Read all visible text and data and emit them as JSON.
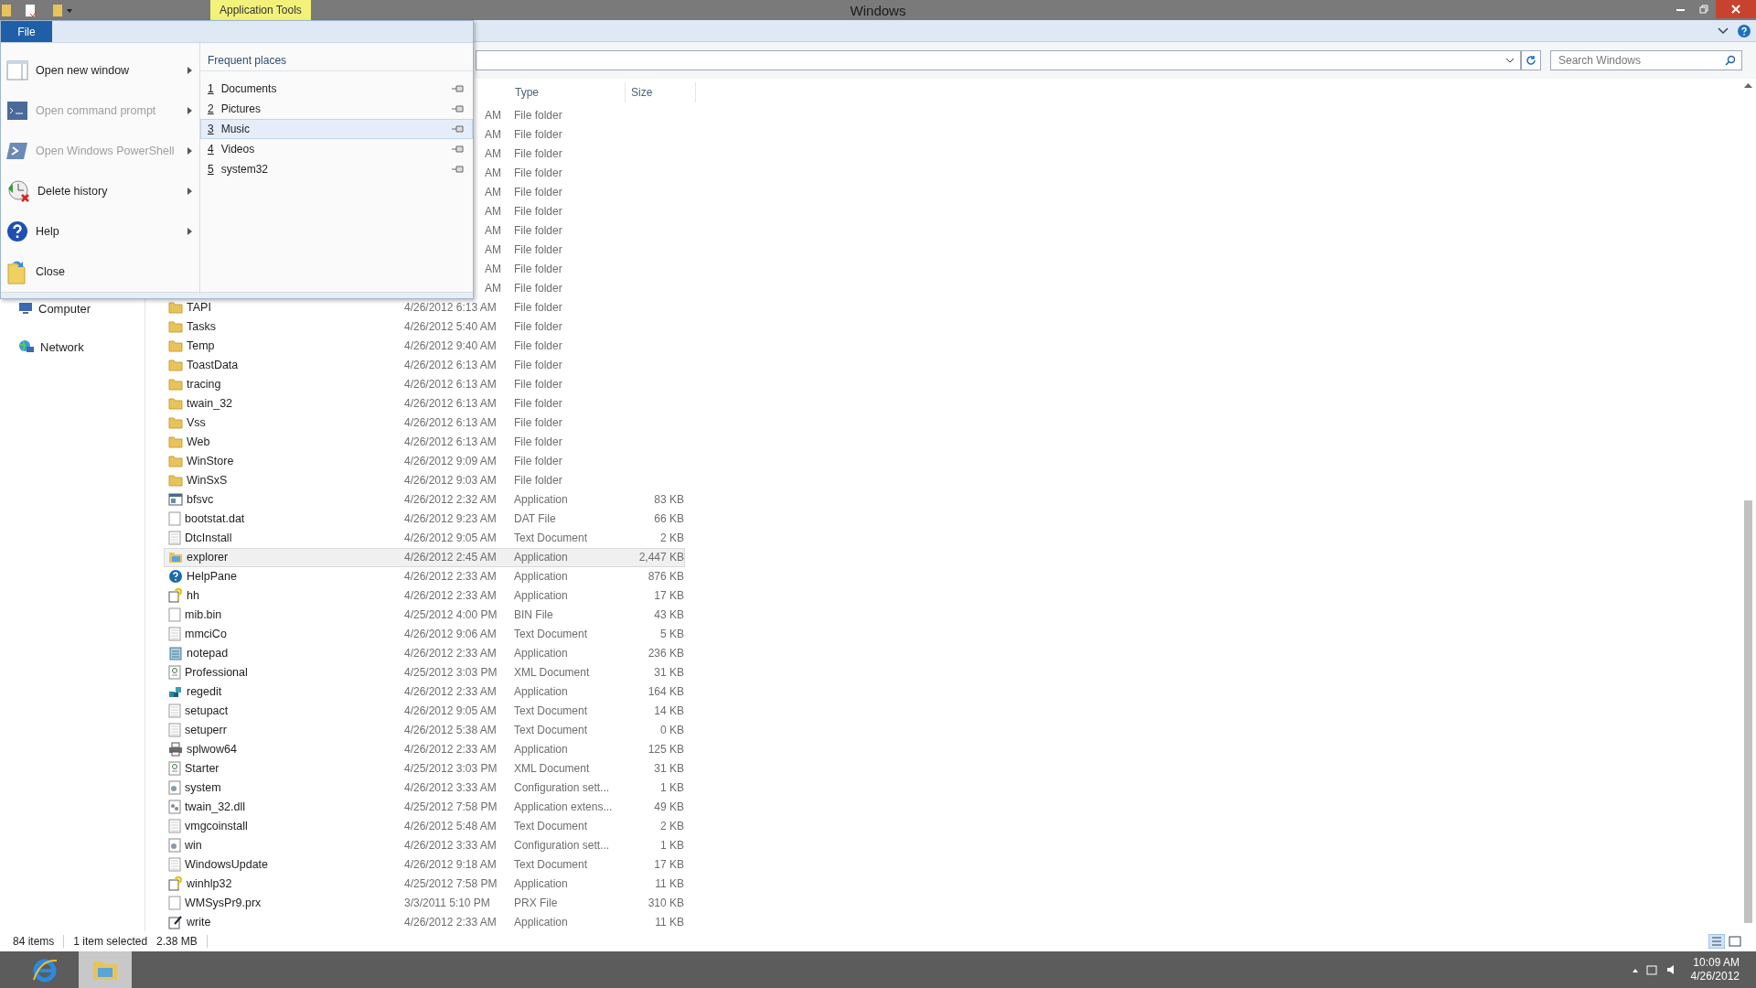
{
  "window": {
    "title": "Windows",
    "context_tab": "Application Tools"
  },
  "ribbon": {
    "file_tab": "File"
  },
  "search": {
    "placeholder": "Search Windows"
  },
  "columns": [
    "Type",
    "Size"
  ],
  "nav": [
    {
      "label": "Computer",
      "kind": "computer"
    },
    {
      "label": "Network",
      "kind": "network"
    }
  ],
  "rows": [
    {
      "date": "AM",
      "type": "File folder",
      "selected": false
    },
    {
      "date": "AM",
      "type": "File folder",
      "selected": false
    },
    {
      "date": "AM",
      "type": "File folder",
      "selected": false
    },
    {
      "date": "AM",
      "type": "File folder",
      "selected": false
    },
    {
      "date": "AM",
      "type": "File folder",
      "selected": false
    },
    {
      "date": "AM",
      "type": "File folder",
      "selected": false
    },
    {
      "date": "AM",
      "type": "File folder",
      "selected": false
    },
    {
      "date": "AM",
      "type": "File folder",
      "selected": false
    },
    {
      "date": "AM",
      "type": "File folder",
      "selected": false
    },
    {
      "date": "AM",
      "type": "File folder",
      "selected": false
    },
    {
      "name": "TAPI",
      "date": "4/26/2012 6:13 AM",
      "type": "File folder",
      "kind": "folder",
      "selected": false
    },
    {
      "name": "Tasks",
      "date": "4/26/2012 5:40 AM",
      "type": "File folder",
      "kind": "folder",
      "selected": false
    },
    {
      "name": "Temp",
      "date": "4/26/2012 9:40 AM",
      "type": "File folder",
      "kind": "folder",
      "selected": false
    },
    {
      "name": "ToastData",
      "date": "4/26/2012 6:13 AM",
      "type": "File folder",
      "kind": "folder",
      "selected": false
    },
    {
      "name": "tracing",
      "date": "4/26/2012 6:13 AM",
      "type": "File folder",
      "kind": "folder",
      "selected": false
    },
    {
      "name": "twain_32",
      "date": "4/26/2012 6:13 AM",
      "type": "File folder",
      "kind": "folder",
      "selected": false
    },
    {
      "name": "Vss",
      "date": "4/26/2012 6:13 AM",
      "type": "File folder",
      "kind": "folder",
      "selected": false
    },
    {
      "name": "Web",
      "date": "4/26/2012 6:13 AM",
      "type": "File folder",
      "kind": "folder",
      "selected": false
    },
    {
      "name": "WinStore",
      "date": "4/26/2012 9:09 AM",
      "type": "File folder",
      "kind": "folder",
      "selected": false
    },
    {
      "name": "WinSxS",
      "date": "4/26/2012 9:03 AM",
      "type": "File folder",
      "kind": "folder",
      "selected": false
    },
    {
      "name": "bfsvc",
      "date": "4/26/2012 2:32 AM",
      "type": "Application",
      "size": "83 KB",
      "kind": "app",
      "selected": false
    },
    {
      "name": "bootstat.dat",
      "date": "4/26/2012 9:23 AM",
      "type": "DAT File",
      "size": "66 KB",
      "kind": "file",
      "selected": false
    },
    {
      "name": "DtcInstall",
      "date": "4/26/2012 9:05 AM",
      "type": "Text Document",
      "size": "2 KB",
      "kind": "text",
      "selected": false
    },
    {
      "name": "explorer",
      "date": "4/26/2012 2:45 AM",
      "type": "Application",
      "size": "2,447 KB",
      "kind": "explorer",
      "selected": true
    },
    {
      "name": "HelpPane",
      "date": "4/26/2012 2:33 AM",
      "type": "Application",
      "size": "876 KB",
      "kind": "help",
      "selected": false
    },
    {
      "name": "hh",
      "date": "4/26/2012 2:33 AM",
      "type": "Application",
      "size": "17 KB",
      "kind": "hh",
      "selected": false
    },
    {
      "name": "mib.bin",
      "date": "4/25/2012 4:00 PM",
      "type": "BIN File",
      "size": "43 KB",
      "kind": "file",
      "selected": false
    },
    {
      "name": "mmciCo",
      "date": "4/26/2012 9:06 AM",
      "type": "Text Document",
      "size": "5 KB",
      "kind": "text",
      "selected": false
    },
    {
      "name": "notepad",
      "date": "4/26/2012 2:33 AM",
      "type": "Application",
      "size": "236 KB",
      "kind": "notepad",
      "selected": false
    },
    {
      "name": "Professional",
      "date": "4/25/2012 3:03 PM",
      "type": "XML Document",
      "size": "31 KB",
      "kind": "xml",
      "selected": false
    },
    {
      "name": "regedit",
      "date": "4/26/2012 2:33 AM",
      "type": "Application",
      "size": "164 KB",
      "kind": "regedit",
      "selected": false
    },
    {
      "name": "setupact",
      "date": "4/26/2012 9:05 AM",
      "type": "Text Document",
      "size": "14 KB",
      "kind": "text",
      "selected": false
    },
    {
      "name": "setuperr",
      "date": "4/26/2012 5:38 AM",
      "type": "Text Document",
      "size": "0 KB",
      "kind": "text",
      "selected": false
    },
    {
      "name": "splwow64",
      "date": "4/26/2012 2:33 AM",
      "type": "Application",
      "size": "125 KB",
      "kind": "printer",
      "selected": false
    },
    {
      "name": "Starter",
      "date": "4/25/2012 3:03 PM",
      "type": "XML Document",
      "size": "31 KB",
      "kind": "xml",
      "selected": false
    },
    {
      "name": "system",
      "date": "4/26/2012 3:33 AM",
      "type": "Configuration sett...",
      "size": "1 KB",
      "kind": "config",
      "selected": false
    },
    {
      "name": "twain_32.dll",
      "date": "4/25/2012 7:58 PM",
      "type": "Application extens...",
      "size": "49 KB",
      "kind": "dll",
      "selected": false
    },
    {
      "name": "vmgcoinstall",
      "date": "4/26/2012 5:48 AM",
      "type": "Text Document",
      "size": "2 KB",
      "kind": "text",
      "selected": false
    },
    {
      "name": "win",
      "date": "4/26/2012 3:33 AM",
      "type": "Configuration sett...",
      "size": "1 KB",
      "kind": "config",
      "selected": false
    },
    {
      "name": "WindowsUpdate",
      "date": "4/26/2012 9:18 AM",
      "type": "Text Document",
      "size": "17 KB",
      "kind": "text",
      "selected": false
    },
    {
      "name": "winhlp32",
      "date": "4/25/2012 7:58 PM",
      "type": "Application",
      "size": "11 KB",
      "kind": "hh",
      "selected": false
    },
    {
      "name": "WMSysPr9.prx",
      "date": "3/3/2011 5:10 PM",
      "type": "PRX File",
      "size": "310 KB",
      "kind": "file",
      "selected": false
    },
    {
      "name": "write",
      "date": "4/26/2012 2:33 AM",
      "type": "Application",
      "size": "11 KB",
      "kind": "write",
      "selected": false
    }
  ],
  "status_bar": {
    "count": "84 items",
    "selection": "1 item selected",
    "size": "2.38 MB"
  },
  "file_menu": {
    "commands": [
      {
        "label": "Open new window",
        "kind": "window",
        "disabled": false,
        "submenu": true
      },
      {
        "label": "Open command prompt",
        "kind": "cmd",
        "disabled": true,
        "submenu": true
      },
      {
        "label": "Open Windows PowerShell",
        "kind": "powershell",
        "disabled": true,
        "submenu": true
      },
      {
        "label": "Delete history",
        "kind": "history",
        "disabled": false,
        "submenu": true
      },
      {
        "label": "Help",
        "kind": "help",
        "disabled": false,
        "submenu": true
      },
      {
        "label": "Close",
        "kind": "close",
        "disabled": false,
        "submenu": false
      }
    ],
    "places_title": "Frequent places",
    "places": [
      {
        "number": "1",
        "label": "Documents",
        "highlighted": false
      },
      {
        "number": "2",
        "label": "Pictures",
        "highlighted": false
      },
      {
        "number": "3",
        "label": "Music",
        "highlighted": true
      },
      {
        "number": "4",
        "label": "Videos",
        "highlighted": false
      },
      {
        "number": "5",
        "label": "system32",
        "highlighted": false
      }
    ]
  },
  "taskbar": {
    "apps": [
      {
        "kind": "ie",
        "selected": false
      },
      {
        "kind": "explorer",
        "selected": true
      }
    ],
    "time": "10:09 AM",
    "date": "4/26/2012"
  }
}
